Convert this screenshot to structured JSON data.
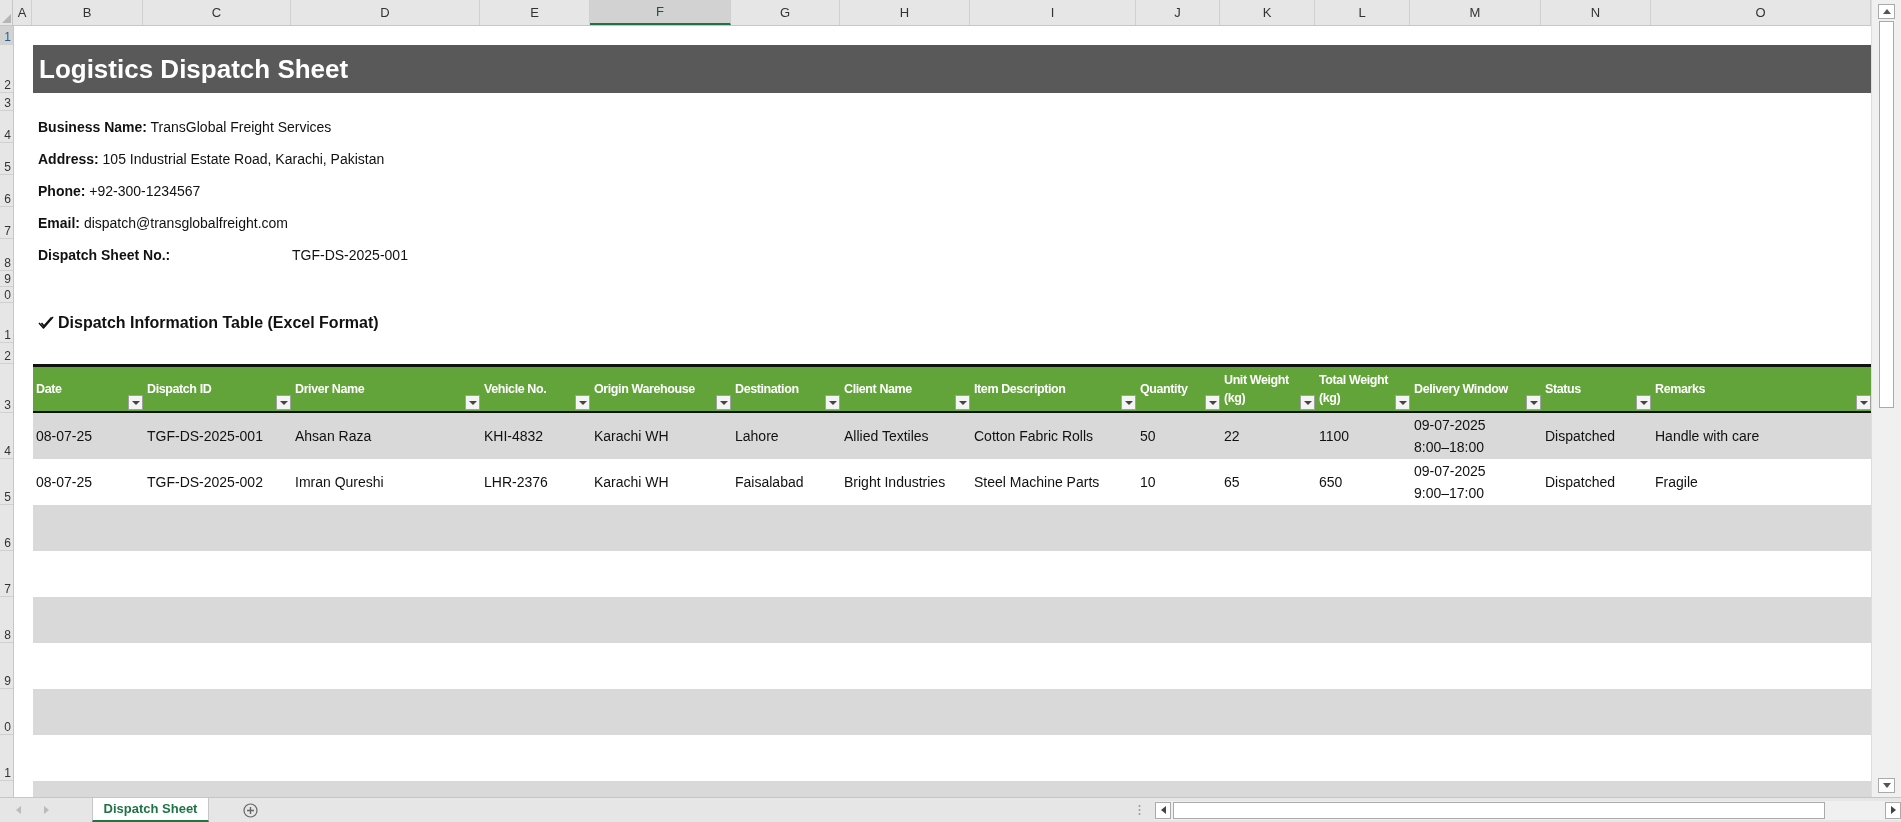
{
  "column_letters": [
    {
      "label": "A",
      "selected": false
    },
    {
      "label": "B",
      "selected": false
    },
    {
      "label": "C",
      "selected": false
    },
    {
      "label": "D",
      "selected": false
    },
    {
      "label": "E",
      "selected": false
    },
    {
      "label": "F",
      "selected": true
    },
    {
      "label": "G",
      "selected": false
    },
    {
      "label": "H",
      "selected": false
    },
    {
      "label": "I",
      "selected": false
    },
    {
      "label": "J",
      "selected": false
    },
    {
      "label": "K",
      "selected": false
    },
    {
      "label": "L",
      "selected": false
    },
    {
      "label": "M",
      "selected": false
    },
    {
      "label": "N",
      "selected": false
    },
    {
      "label": "O",
      "selected": false
    }
  ],
  "row_numbers": [
    {
      "label": "1",
      "selected": true
    },
    {
      "label": "2",
      "selected": false
    },
    {
      "label": "3",
      "selected": false
    },
    {
      "label": "4",
      "selected": false
    },
    {
      "label": "5",
      "selected": false
    },
    {
      "label": "6",
      "selected": false
    },
    {
      "label": "7",
      "selected": false
    },
    {
      "label": "8",
      "selected": false
    },
    {
      "label": "9",
      "selected": false
    },
    {
      "label": "0",
      "selected": false
    },
    {
      "label": "1",
      "selected": false
    },
    {
      "label": "2",
      "selected": false
    },
    {
      "label": "3",
      "selected": false
    },
    {
      "label": "4",
      "selected": false
    },
    {
      "label": "5",
      "selected": false
    },
    {
      "label": "6",
      "selected": false
    },
    {
      "label": "7",
      "selected": false
    },
    {
      "label": "8",
      "selected": false
    },
    {
      "label": "9",
      "selected": false
    },
    {
      "label": "0",
      "selected": false
    },
    {
      "label": "1",
      "selected": false
    }
  ],
  "title": "Logistics Dispatch Sheet",
  "business_info": [
    {
      "kind": "inline",
      "label": "Business Name:",
      "value": "TransGlobal Freight Services"
    },
    {
      "kind": "inline",
      "label": "Address:",
      "value": "105 Industrial Estate Road, Karachi, Pakistan"
    },
    {
      "kind": "inline",
      "label": "Phone:",
      "value": "+92-300-1234567"
    },
    {
      "kind": "inline",
      "label": "Email:",
      "value": "dispatch@transglobalfreight.com"
    },
    {
      "kind": "split",
      "label": "Dispatch Sheet No.:",
      "value": "TGF-DS-2025-001"
    }
  ],
  "section_heading": "Dispatch Information Table (Excel Format)",
  "table": {
    "columns": [
      "Date",
      "Dispatch ID",
      "Driver Name",
      "Vehicle No.",
      "Origin Warehouse",
      "Destination",
      "Client Name",
      "Item Description",
      "Quantity",
      "Unit Weight (kg)",
      "Total Weight (kg)",
      "Delivery Window",
      "Status",
      "Remarks"
    ],
    "rows": [
      [
        "08-07-25",
        "TGF-DS-2025-001",
        "Ahsan Raza",
        "KHI-4832",
        "Karachi WH",
        "Lahore",
        "Allied Textiles",
        "Cotton Fabric Rolls",
        "50",
        "22",
        "1100",
        "09-07-2025 8:00–18:00",
        "Dispatched",
        "Handle with care"
      ],
      [
        "08-07-25",
        "TGF-DS-2025-002",
        "Imran Qureshi",
        "LHR-2376",
        "Karachi WH",
        "Faisalabad",
        "Bright Industries",
        "Steel Machine Parts",
        "10",
        "65",
        "650",
        "09-07-2025 9:00–17:00",
        "Dispatched",
        "Fragile"
      ]
    ]
  },
  "sheet_tabs": [
    {
      "label": "Dispatch Sheet",
      "selected": true
    }
  ]
}
